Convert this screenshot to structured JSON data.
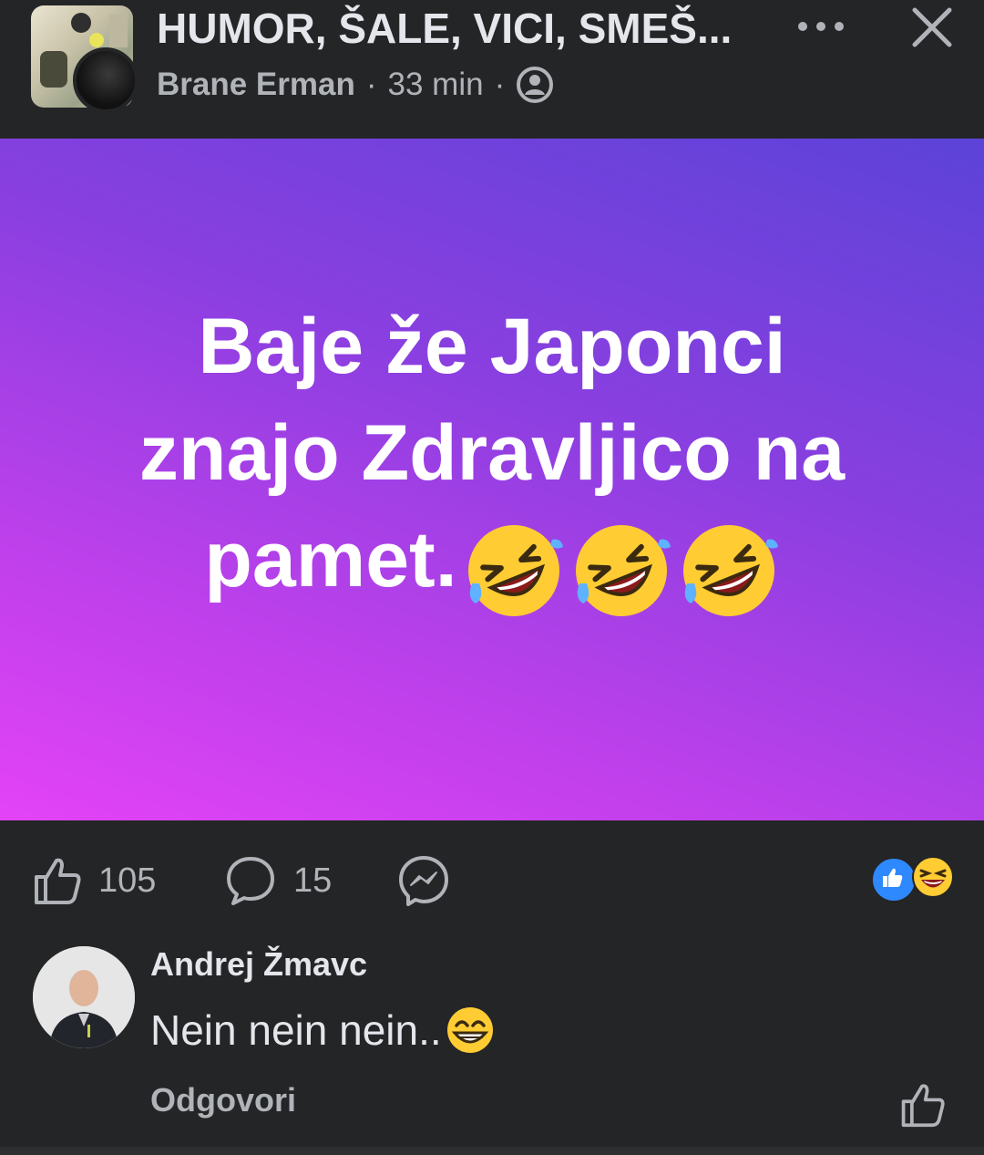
{
  "header": {
    "group_title": "HUMOR, ŠALE, VICI, SMEŠ...",
    "author": "Brane Erman",
    "time": "33 min",
    "separator": "·"
  },
  "post": {
    "text_line1": "Baje že Japonci",
    "text_line2": "znajo Zdravljico na",
    "text_line3": "pamet.",
    "emoji": "rolling-on-floor-laughing",
    "emoji_count": 3,
    "background_colors": [
      "#e343f6",
      "#5c43d8"
    ]
  },
  "actions": {
    "like_count": "105",
    "comment_count": "15",
    "reactions": [
      "like",
      "haha"
    ]
  },
  "comment": {
    "author": "Andrej Žmavc",
    "text": "Nein nein nein..",
    "reply_label": "Odgovori"
  },
  "colors": {
    "background": "#242526",
    "text_primary": "#e4e6eb",
    "text_secondary": "#b0b3b8",
    "like_blue": "#2e89ff"
  }
}
